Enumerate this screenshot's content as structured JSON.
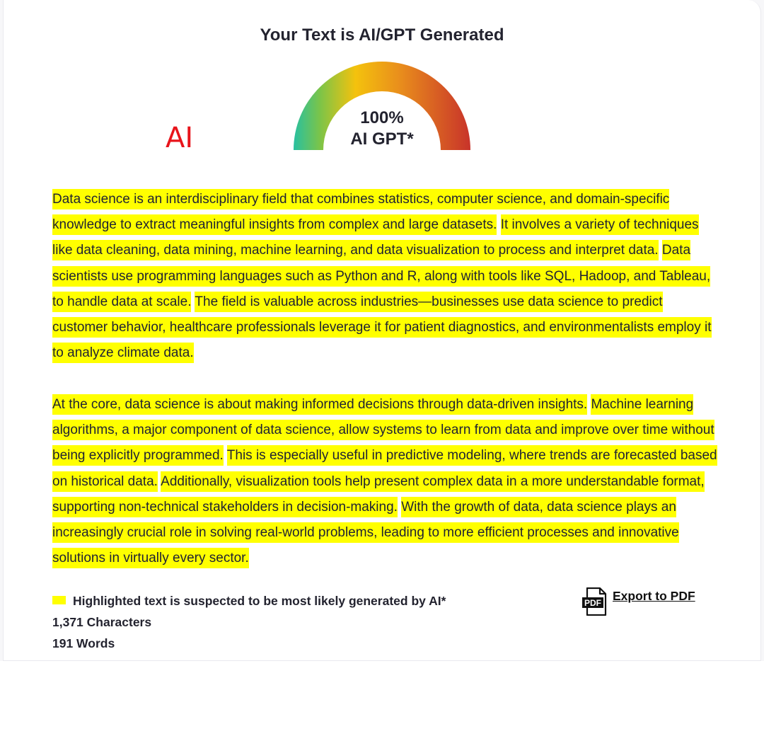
{
  "header": {
    "title": "Your Text is AI/GPT Generated"
  },
  "verdict": {
    "label": "AI",
    "color": "#e8141b"
  },
  "gauge": {
    "percent": 100,
    "percent_text": "100%",
    "caption": "AI GPT*",
    "colors": [
      "#28c0a0",
      "#f4c20d",
      "#c8332a"
    ]
  },
  "text": {
    "paragraph1": [
      "Data science is an interdisciplinary field that combines statistics, computer science, and domain-specific knowledge to extract meaningful insights from complex and large datasets.",
      "It involves a variety of techniques like data cleaning, data mining, machine learning, and data visualization to process and interpret data.",
      "Data scientists use programming languages such as Python and R, along with tools like SQL, Hadoop, and Tableau, to handle data at scale.",
      "The field is valuable across industries—businesses use data science to predict customer behavior, healthcare professionals leverage it for patient diagnostics, and environmentalists employ it to analyze climate data."
    ],
    "paragraph2": [
      "At the core, data science is about making informed decisions through data-driven insights.",
      "Machine learning algorithms, a major component of data science, allow systems to learn from data and improve over time without being explicitly programmed.",
      "This is especially useful in predictive modeling, where trends are forecasted based on historical data.",
      "Additionally, visualization tools help present complex data in a more understandable format, supporting non-technical stakeholders in decision-making.",
      "With the growth of data, data science plays an increasingly crucial role in solving real-world problems, leading to more efficient processes and innovative solutions in virtually every sector."
    ],
    "highlight_color": "#ffff00"
  },
  "footer": {
    "legend": "Highlighted text is suspected to be most likely generated by AI*",
    "characters": "1,371 Characters",
    "words": "191 Words",
    "export_label": "Export to PDF",
    "export_icon": "pdf-file-icon",
    "export_icon_text": "PDF"
  }
}
